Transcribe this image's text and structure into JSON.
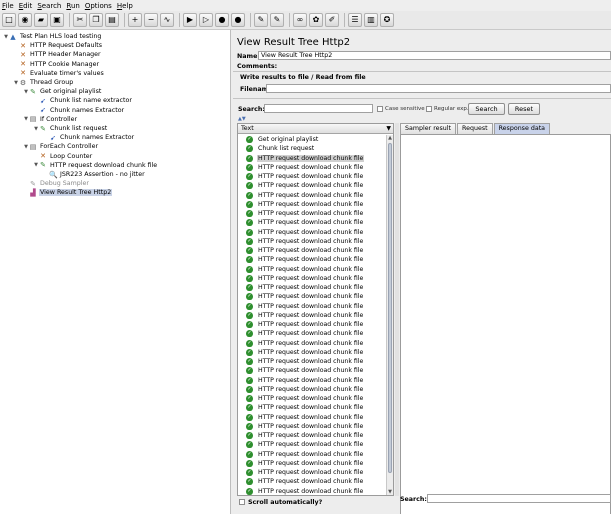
{
  "menu": [
    "File",
    "Edit",
    "Search",
    "Run",
    "Options",
    "Help"
  ],
  "toolbar": [
    {
      "icon": "new-icon",
      "glyph": "□"
    },
    {
      "icon": "templates-icon",
      "glyph": "◉"
    },
    {
      "icon": "open-icon",
      "glyph": "▰"
    },
    {
      "icon": "save-icon",
      "glyph": "▣"
    },
    {
      "sep": true
    },
    {
      "icon": "cut-icon",
      "glyph": "✂"
    },
    {
      "icon": "copy-icon",
      "glyph": "❐"
    },
    {
      "icon": "paste-icon",
      "glyph": "▤"
    },
    {
      "sep": true
    },
    {
      "icon": "expand-icon",
      "glyph": "+"
    },
    {
      "icon": "collapse-icon",
      "glyph": "−"
    },
    {
      "icon": "toggle-icon",
      "glyph": "∿"
    },
    {
      "sep": true
    },
    {
      "icon": "start-icon",
      "glyph": "▶"
    },
    {
      "icon": "start-no-pauses-icon",
      "glyph": "▷"
    },
    {
      "icon": "stop-icon",
      "glyph": "●"
    },
    {
      "icon": "shutdown-icon",
      "glyph": "●"
    },
    {
      "sep": true
    },
    {
      "icon": "clear-icon",
      "glyph": "✎"
    },
    {
      "icon": "clear-all-icon",
      "glyph": "✎"
    },
    {
      "sep": true
    },
    {
      "icon": "search-binoculars-icon",
      "glyph": "∞"
    },
    {
      "icon": "reset-search-icon",
      "glyph": "✿"
    },
    {
      "icon": "function-helper-icon",
      "glyph": "✐"
    },
    {
      "sep": true
    },
    {
      "icon": "list-icon",
      "glyph": "☰"
    },
    {
      "icon": "help-icon",
      "glyph": "▥"
    },
    {
      "icon": "remote-icon",
      "glyph": "✪"
    }
  ],
  "tree": [
    {
      "label": "Test Plan HLS load testing",
      "icon": "test-plan-icon",
      "glyph": "▲",
      "color": "#3a6fb5",
      "depth": 0,
      "toggle": "▼"
    },
    {
      "label": "HTTP Request Defaults",
      "icon": "config-element-icon",
      "glyph": "✕",
      "color": "#b05a14",
      "depth": 1
    },
    {
      "label": "HTTP Header Manager",
      "icon": "config-element-icon",
      "glyph": "✕",
      "color": "#b05a14",
      "depth": 1
    },
    {
      "label": "HTTP Cookie Manager",
      "icon": "config-element-icon",
      "glyph": "✕",
      "color": "#b05a14",
      "depth": 1
    },
    {
      "label": "Evaluate timer's values",
      "icon": "config-element-icon",
      "glyph": "✕",
      "color": "#b05a14",
      "depth": 1
    },
    {
      "label": "Thread Group",
      "icon": "thread-group-icon",
      "glyph": "⚙",
      "color": "#555555",
      "depth": 1,
      "toggle": "▼"
    },
    {
      "label": "Get original playlist",
      "icon": "sampler-icon",
      "glyph": "✎",
      "color": "#3d8b3d",
      "depth": 2,
      "toggle": "▼"
    },
    {
      "label": "Chunk list name extractor",
      "icon": "post-processor-icon",
      "glyph": "➹",
      "color": "#2d59b5",
      "depth": 3
    },
    {
      "label": "Chunk names Extractor",
      "icon": "post-processor-icon",
      "glyph": "➹",
      "color": "#2d59b5",
      "depth": 3
    },
    {
      "label": "If Controller",
      "icon": "logic-controller-icon",
      "glyph": "▤",
      "color": "#5a5a5a",
      "depth": 2,
      "toggle": "▼"
    },
    {
      "label": "Chunk list request",
      "icon": "sampler-icon",
      "glyph": "✎",
      "color": "#3d8b3d",
      "depth": 3,
      "toggle": "▼"
    },
    {
      "label": "Chunk names Extractor",
      "icon": "post-processor-icon",
      "glyph": "➹",
      "color": "#2d59b5",
      "depth": 4
    },
    {
      "label": "ForEach Controller",
      "icon": "logic-controller-icon",
      "glyph": "▤",
      "color": "#5a5a5a",
      "depth": 2,
      "toggle": "▼"
    },
    {
      "label": "Loop Counter",
      "icon": "config-element-icon",
      "glyph": "✕",
      "color": "#b05a14",
      "depth": 3
    },
    {
      "label": "HTTP request download chunk file",
      "icon": "sampler-icon",
      "glyph": "✎",
      "color": "#3d8b3d",
      "depth": 3,
      "toggle": "▼"
    },
    {
      "label": "JSR223 Assertion - no jitter",
      "icon": "assertion-icon",
      "glyph": "🔍",
      "color": "#444444",
      "depth": 4
    },
    {
      "label": "Debug Sampler",
      "icon": "debug-sampler-icon",
      "glyph": "✎",
      "color": "#9a9a9a",
      "depth": 2,
      "disabled": true
    },
    {
      "label": "View Result Tree Http2",
      "icon": "listener-icon",
      "glyph": "▟",
      "color": "#b04a8c",
      "depth": 2,
      "selected": true
    }
  ],
  "panel": {
    "title": "View Result Tree Http2",
    "name_label": "Name:",
    "name_value": "View Result Tree Http2",
    "comments_label": "Comments:",
    "write_results_label": "Write results to file / Read from file",
    "filename_label": "Filename",
    "search_label": "Search:",
    "case_sensitive_label": "Case sensitive",
    "regex_label": "Regular exp.",
    "search_button": "Search",
    "reset_button": "Reset",
    "list_header": "Text",
    "scroll_auto_label": "Scroll automatically?",
    "detail_search_label": "Search:",
    "tabs": [
      "Sampler result",
      "Request",
      "Response data"
    ],
    "active_tab": 2
  },
  "results": [
    "Get original playlist",
    "Chunk list request",
    "HTTP request download chunk file",
    "HTTP request download chunk file",
    "HTTP request download chunk file",
    "HTTP request download chunk file",
    "HTTP request download chunk file",
    "HTTP request download chunk file",
    "HTTP request download chunk file",
    "HTTP request download chunk file",
    "HTTP request download chunk file",
    "HTTP request download chunk file",
    "HTTP request download chunk file",
    "HTTP request download chunk file",
    "HTTP request download chunk file",
    "HTTP request download chunk file",
    "HTTP request download chunk file",
    "HTTP request download chunk file",
    "HTTP request download chunk file",
    "HTTP request download chunk file",
    "HTTP request download chunk file",
    "HTTP request download chunk file",
    "HTTP request download chunk file",
    "HTTP request download chunk file",
    "HTTP request download chunk file",
    "HTTP request download chunk file",
    "HTTP request download chunk file",
    "HTTP request download chunk file",
    "HTTP request download chunk file",
    "HTTP request download chunk file",
    "HTTP request download chunk file",
    "HTTP request download chunk file",
    "HTTP request download chunk file",
    "HTTP request download chunk file",
    "HTTP request download chunk file",
    "HTTP request download chunk file",
    "HTTP request download chunk file",
    "HTTP request download chunk file",
    "HTTP request download chunk file"
  ],
  "highlighted_result": 2,
  "colors": {
    "success": "#2f8f2f",
    "selection": "#c8d2e6",
    "active_tab": "#c9d3ea"
  }
}
